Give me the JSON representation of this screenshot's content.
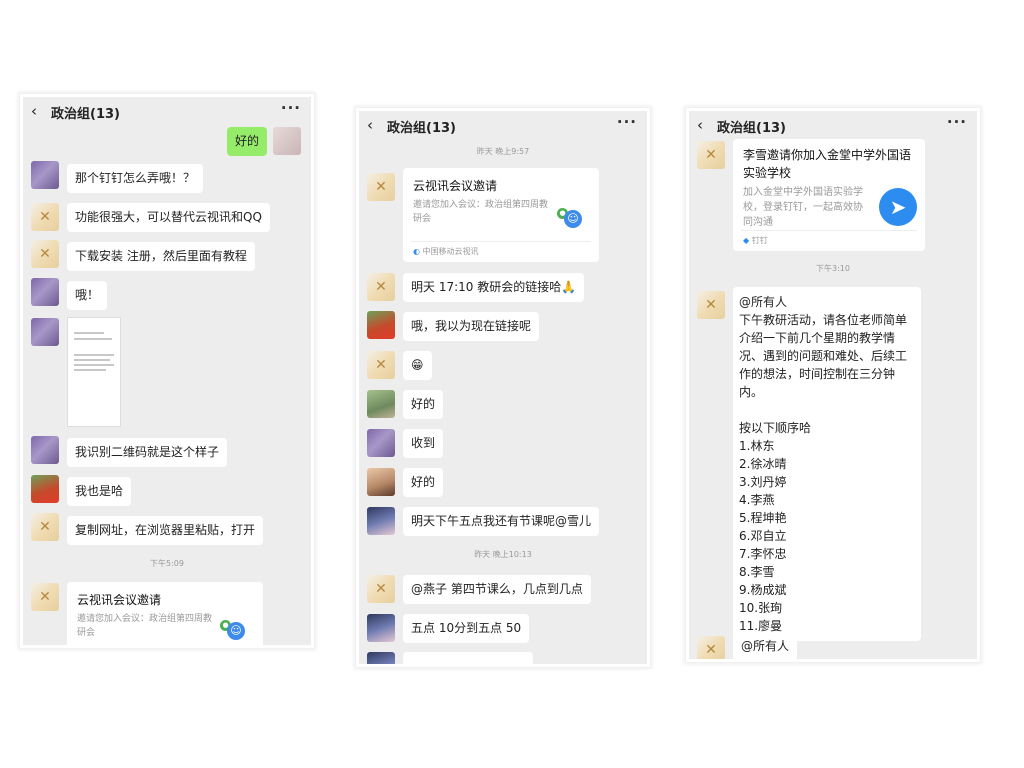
{
  "screen1": {
    "title": "政治组(13)",
    "back_icon": "‹",
    "more_icon": "···",
    "sent_message": "好的",
    "messages": [
      "那个钉钉怎么弄哦！？",
      "功能很强大，可以替代云视讯和QQ",
      "下载安装 注册，然后里面有教程",
      "哦！",
      "我识别二维码就是这个样子",
      "我也是哈",
      "复制网址，在浏览器里粘贴，打开"
    ],
    "timestamp": "下午5:09",
    "card": {
      "title": "云视讯会议邀请",
      "desc": "邀请您加入会议：政治组第四周教研会"
    }
  },
  "screen2": {
    "title": "政治组(13)",
    "back_icon": "‹",
    "more_icon": "···",
    "timestamp1": "昨天 晚上9:57",
    "card": {
      "title": "云视讯会议邀请",
      "desc": "邀请您加入会议：政治组第四周教研会",
      "footer": "中国移动云视讯"
    },
    "messages": [
      "明天 17:10 教研会的链接哈🙏",
      "哦，我以为现在链接呢",
      "😁",
      "好的",
      "收到",
      "好的",
      "明天下午五点我还有节课呢@雪儿"
    ],
    "timestamp2": "昨天 晚上10:13",
    "messages2": [
      "@燕子  第四节课么，几点到几点",
      "五点 10分到五点 50"
    ]
  },
  "screen3": {
    "title": "政治组(13)",
    "back_icon": "‹",
    "more_icon": "···",
    "ding_card": {
      "title": "李雪邀请你加入金堂中学外国语实验学校",
      "desc": "加入金堂中学外国语实验学校，登录钉钉，一起高效协同沟通",
      "footer": "钉钉"
    },
    "timestamp": "下午3:10",
    "notice": "@所有人\n下午教研活动，请各位老师简单介绍一下前几个星期的教学情况、遇到的问题和难处、后续工作的想法，时间控制在三分钟内。\n\n按以下顺序哈\n1.林东\n2.徐冰晴\n3.刘丹婷\n4.李燕\n5.程坤艳\n6.邓自立\n7.李怀忠\n8.李雪\n9.杨成斌\n10.张珣\n11.廖曼",
    "partial_message": "@所有人"
  }
}
